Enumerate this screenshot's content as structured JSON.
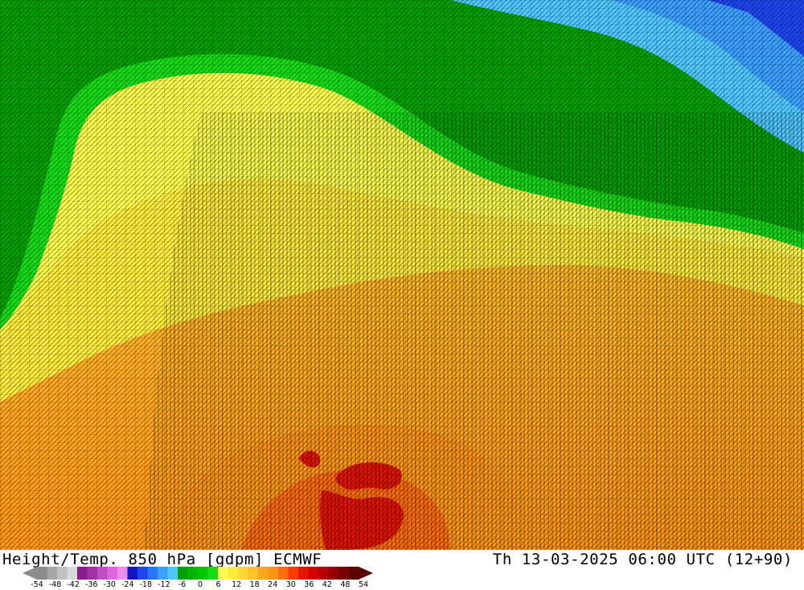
{
  "title": {
    "left": "Height/Temp. 850 hPa [gdpm] ECMWF",
    "right": "Th 13-03-2025 06:00 UTC (12+90)"
  },
  "legend": {
    "ticks": [
      "-54",
      "-48",
      "-42",
      "-36",
      "-30",
      "-24",
      "-18",
      "-12",
      "-6",
      "0",
      "6",
      "12",
      "18",
      "24",
      "30",
      "36",
      "42",
      "48",
      "54"
    ],
    "colors": [
      "#8c8c8c",
      "#a6a6a6",
      "#bfbfbf",
      "#d9d9d9",
      "#8a1e8a",
      "#a233a2",
      "#c24dc2",
      "#e066e0",
      "#f08cf0",
      "#1414c8",
      "#1e46f0",
      "#2878ff",
      "#3ca0ff",
      "#50c8ff",
      "#00a000",
      "#00b400",
      "#00c800",
      "#14dc14",
      "#ffff50",
      "#ffeb3c",
      "#ffd732",
      "#ffc328",
      "#ffaa1e",
      "#ff9614",
      "#ff6e0a",
      "#ff3c00",
      "#e61400",
      "#d20000",
      "#b40000",
      "#960000",
      "#780000",
      "#5a0000"
    ]
  },
  "map": {
    "palette": {
      "dark_blue": "#1e46f0",
      "light_blue": "#3ca0ff",
      "cyan": "#50c8ff",
      "green": "#00a000",
      "bright_green": "#14dc14",
      "yellow": "#ffff50",
      "gold": "#ffd732",
      "orange_light": "#ffc328",
      "orange": "#ffaa1e",
      "dark_orange": "#ff9614",
      "red_orange": "#ff6e0a",
      "red": "#e61400",
      "deep_red": "#d20000"
    }
  }
}
